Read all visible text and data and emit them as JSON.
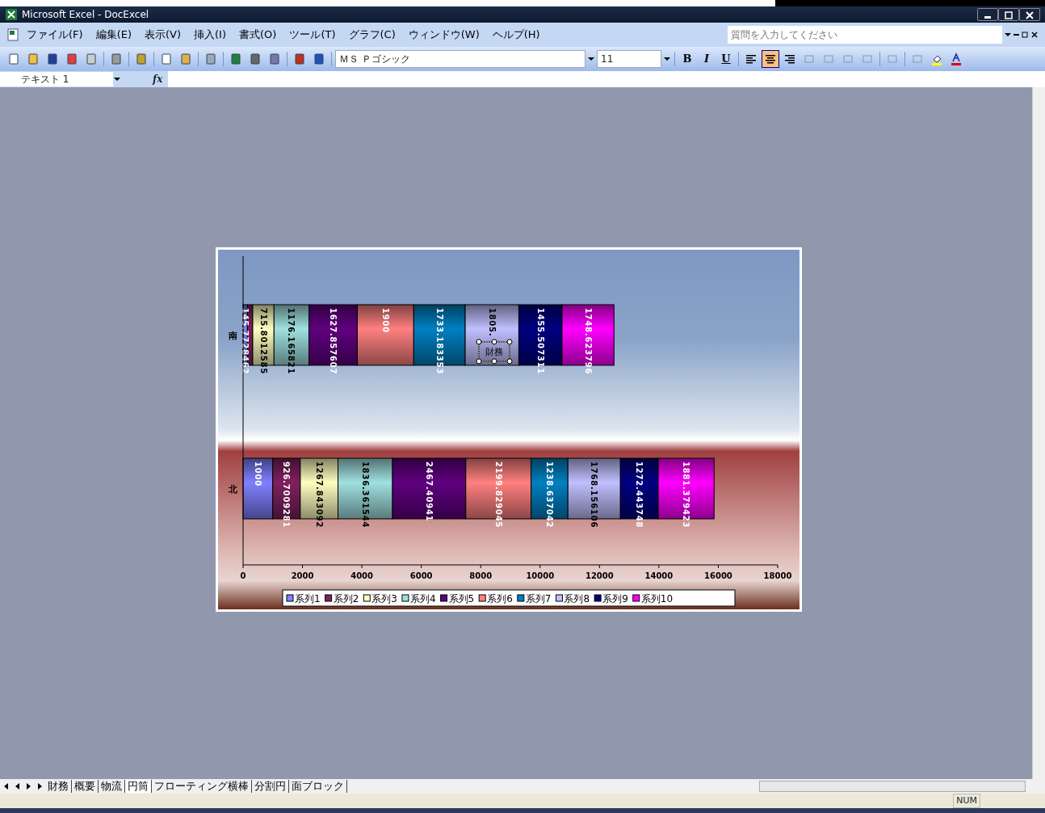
{
  "window": {
    "title": "Microsoft Excel - DocExcel"
  },
  "menu": [
    "ファイル(F)",
    "編集(E)",
    "表示(V)",
    "挿入(I)",
    "書式(O)",
    "ツール(T)",
    "グラフ(C)",
    "ウィンドウ(W)",
    "ヘルプ(H)"
  ],
  "help_search": {
    "placeholder": "質問を入力してください"
  },
  "formatting": {
    "font": "ＭＳ Ｐゴシック",
    "size": "11",
    "style_buttons": [
      "B",
      "I",
      "U"
    ],
    "align_buttons": [
      {
        "selected": false
      },
      {
        "selected": true
      },
      {
        "selected": false
      }
    ]
  },
  "name_box": "テキスト 1",
  "formula_icon": "fx",
  "chart": {
    "text_box": "財務",
    "chart_data": {
      "type": "bar",
      "orientation": "horizontal",
      "stacked": true,
      "categories": [
        "南",
        "北"
      ],
      "xlim": [
        0,
        18000
      ],
      "xticks": [
        0,
        2000,
        4000,
        6000,
        8000,
        10000,
        12000,
        14000,
        16000,
        18000
      ],
      "legend": "bottom",
      "series": [
        {
          "name": "系列1",
          "color": "#8080ff",
          "values": [
            145.7728462,
            1000
          ],
          "value_labels": [
            "145.7728462",
            "1000"
          ]
        },
        {
          "name": "系列2",
          "color": "#802060",
          "values": [
            180,
            926.7009281
          ],
          "value_labels": [
            null,
            "926.7009281"
          ]
        },
        {
          "name": "系列3",
          "color": "#ffffc0",
          "values": [
            715.8012585,
            1267.843092
          ],
          "value_labels": [
            "715.8012585",
            "1267.843092"
          ]
        },
        {
          "name": "系列4",
          "color": "#a0e0e0",
          "values": [
            1176.165821,
            1836.361544
          ],
          "value_labels": [
            "1176.165821",
            "1836.361544"
          ]
        },
        {
          "name": "系列5",
          "color": "#600080",
          "values": [
            1627.857607,
            2467.40941
          ],
          "value_labels": [
            "1627.857607",
            "2467.40941"
          ]
        },
        {
          "name": "系列6",
          "color": "#ff8080",
          "values": [
            1900,
            2199.829045
          ],
          "value_labels": [
            "1900",
            "2199.829045"
          ]
        },
        {
          "name": "系列7",
          "color": "#0080c0",
          "values": [
            1733.183353,
            1238.637042
          ],
          "value_labels": [
            "1733.183353",
            "1238.637042"
          ]
        },
        {
          "name": "系列8",
          "color": "#c0c0ff",
          "values": [
            1805,
            1768.156106
          ],
          "value_labels": [
            "1805.",
            "1768.156106"
          ]
        },
        {
          "name": "系列9",
          "color": "#000080",
          "values": [
            1455.507311,
            1272.443748
          ],
          "value_labels": [
            "1455.507311",
            "1272.443748"
          ]
        },
        {
          "name": "系列10",
          "color": "#ff00ff",
          "values": [
            1748.623796,
            1881.379423
          ],
          "value_labels": [
            "1748.623796",
            "1881.379423"
          ]
        }
      ]
    }
  },
  "sheet_tabs": [
    {
      "label": "財務",
      "selected": false
    },
    {
      "label": "概要",
      "selected": false
    },
    {
      "label": "物流",
      "selected": false
    },
    {
      "label": "円筒",
      "selected": true
    },
    {
      "label": "フローティング横棒",
      "selected": false
    },
    {
      "label": "分割円",
      "selected": false
    },
    {
      "label": "面ブロック",
      "selected": false
    }
  ],
  "status_bar": {
    "num": "NUM"
  }
}
